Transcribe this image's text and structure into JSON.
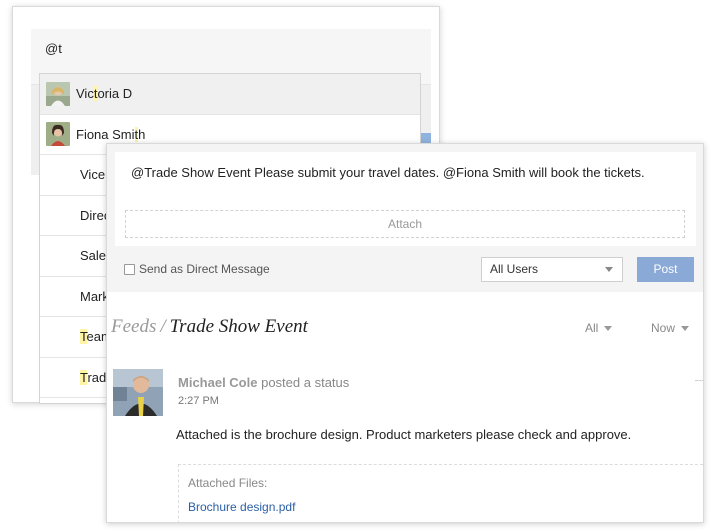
{
  "mention_panel": {
    "input_text": "@t",
    "suggestions": [
      {
        "pre": "Vic",
        "hl": "t",
        "post": "oria D",
        "avatar": "victoria-avatar"
      },
      {
        "pre": "Fiona Smi",
        "hl": "t",
        "post": "h",
        "avatar": "fiona-avatar"
      },
      {
        "pre": "Vice",
        "hl": "",
        "post": ""
      },
      {
        "pre": "Direc",
        "hl": "",
        "post": ""
      },
      {
        "pre": "Sales",
        "hl": "",
        "post": ""
      },
      {
        "pre": "Mark",
        "hl": "",
        "post": ""
      },
      {
        "pre": "",
        "hl": "T",
        "post": "eam"
      },
      {
        "pre": "",
        "hl": "T",
        "post": "rade"
      }
    ]
  },
  "composer": {
    "message": "@Trade Show Event Please submit your travel dates. @Fiona Smith will book the tickets.",
    "attach_label": "Attach",
    "dm_label": "Send as Direct Message",
    "audience_value": "All Users",
    "post_label": "Post"
  },
  "feed": {
    "crumb": "Feeds",
    "separator": "/",
    "current": "Trade Show Event",
    "filter_all": "All",
    "filter_now": "Now"
  },
  "post": {
    "author": "Michael Cole",
    "action": "posted a status",
    "time": "2:27 PM",
    "body": "Attached is the brochure design. Product marketers please check and approve.",
    "files_label": "Attached Files:",
    "file_name": "Brochure design.pdf"
  },
  "colors": {
    "post_button": "#8aa9d7",
    "link": "#2a5fa6",
    "highlight": "#fff3a6"
  }
}
